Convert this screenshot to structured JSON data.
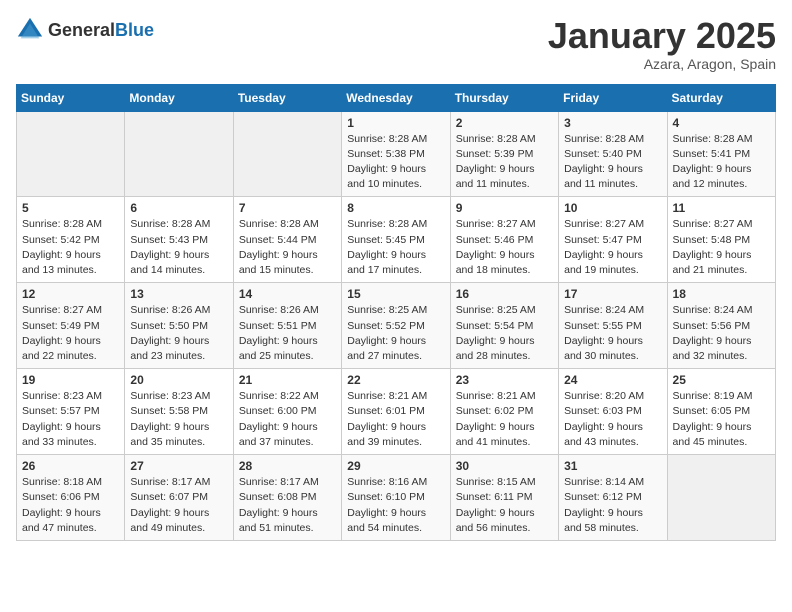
{
  "header": {
    "logo_general": "General",
    "logo_blue": "Blue",
    "month": "January 2025",
    "location": "Azara, Aragon, Spain"
  },
  "weekdays": [
    "Sunday",
    "Monday",
    "Tuesday",
    "Wednesday",
    "Thursday",
    "Friday",
    "Saturday"
  ],
  "weeks": [
    [
      {
        "day": "",
        "info": ""
      },
      {
        "day": "",
        "info": ""
      },
      {
        "day": "",
        "info": ""
      },
      {
        "day": "1",
        "info": "Sunrise: 8:28 AM\nSunset: 5:38 PM\nDaylight: 9 hours\nand 10 minutes."
      },
      {
        "day": "2",
        "info": "Sunrise: 8:28 AM\nSunset: 5:39 PM\nDaylight: 9 hours\nand 11 minutes."
      },
      {
        "day": "3",
        "info": "Sunrise: 8:28 AM\nSunset: 5:40 PM\nDaylight: 9 hours\nand 11 minutes."
      },
      {
        "day": "4",
        "info": "Sunrise: 8:28 AM\nSunset: 5:41 PM\nDaylight: 9 hours\nand 12 minutes."
      }
    ],
    [
      {
        "day": "5",
        "info": "Sunrise: 8:28 AM\nSunset: 5:42 PM\nDaylight: 9 hours\nand 13 minutes."
      },
      {
        "day": "6",
        "info": "Sunrise: 8:28 AM\nSunset: 5:43 PM\nDaylight: 9 hours\nand 14 minutes."
      },
      {
        "day": "7",
        "info": "Sunrise: 8:28 AM\nSunset: 5:44 PM\nDaylight: 9 hours\nand 15 minutes."
      },
      {
        "day": "8",
        "info": "Sunrise: 8:28 AM\nSunset: 5:45 PM\nDaylight: 9 hours\nand 17 minutes."
      },
      {
        "day": "9",
        "info": "Sunrise: 8:27 AM\nSunset: 5:46 PM\nDaylight: 9 hours\nand 18 minutes."
      },
      {
        "day": "10",
        "info": "Sunrise: 8:27 AM\nSunset: 5:47 PM\nDaylight: 9 hours\nand 19 minutes."
      },
      {
        "day": "11",
        "info": "Sunrise: 8:27 AM\nSunset: 5:48 PM\nDaylight: 9 hours\nand 21 minutes."
      }
    ],
    [
      {
        "day": "12",
        "info": "Sunrise: 8:27 AM\nSunset: 5:49 PM\nDaylight: 9 hours\nand 22 minutes."
      },
      {
        "day": "13",
        "info": "Sunrise: 8:26 AM\nSunset: 5:50 PM\nDaylight: 9 hours\nand 23 minutes."
      },
      {
        "day": "14",
        "info": "Sunrise: 8:26 AM\nSunset: 5:51 PM\nDaylight: 9 hours\nand 25 minutes."
      },
      {
        "day": "15",
        "info": "Sunrise: 8:25 AM\nSunset: 5:52 PM\nDaylight: 9 hours\nand 27 minutes."
      },
      {
        "day": "16",
        "info": "Sunrise: 8:25 AM\nSunset: 5:54 PM\nDaylight: 9 hours\nand 28 minutes."
      },
      {
        "day": "17",
        "info": "Sunrise: 8:24 AM\nSunset: 5:55 PM\nDaylight: 9 hours\nand 30 minutes."
      },
      {
        "day": "18",
        "info": "Sunrise: 8:24 AM\nSunset: 5:56 PM\nDaylight: 9 hours\nand 32 minutes."
      }
    ],
    [
      {
        "day": "19",
        "info": "Sunrise: 8:23 AM\nSunset: 5:57 PM\nDaylight: 9 hours\nand 33 minutes."
      },
      {
        "day": "20",
        "info": "Sunrise: 8:23 AM\nSunset: 5:58 PM\nDaylight: 9 hours\nand 35 minutes."
      },
      {
        "day": "21",
        "info": "Sunrise: 8:22 AM\nSunset: 6:00 PM\nDaylight: 9 hours\nand 37 minutes."
      },
      {
        "day": "22",
        "info": "Sunrise: 8:21 AM\nSunset: 6:01 PM\nDaylight: 9 hours\nand 39 minutes."
      },
      {
        "day": "23",
        "info": "Sunrise: 8:21 AM\nSunset: 6:02 PM\nDaylight: 9 hours\nand 41 minutes."
      },
      {
        "day": "24",
        "info": "Sunrise: 8:20 AM\nSunset: 6:03 PM\nDaylight: 9 hours\nand 43 minutes."
      },
      {
        "day": "25",
        "info": "Sunrise: 8:19 AM\nSunset: 6:05 PM\nDaylight: 9 hours\nand 45 minutes."
      }
    ],
    [
      {
        "day": "26",
        "info": "Sunrise: 8:18 AM\nSunset: 6:06 PM\nDaylight: 9 hours\nand 47 minutes."
      },
      {
        "day": "27",
        "info": "Sunrise: 8:17 AM\nSunset: 6:07 PM\nDaylight: 9 hours\nand 49 minutes."
      },
      {
        "day": "28",
        "info": "Sunrise: 8:17 AM\nSunset: 6:08 PM\nDaylight: 9 hours\nand 51 minutes."
      },
      {
        "day": "29",
        "info": "Sunrise: 8:16 AM\nSunset: 6:10 PM\nDaylight: 9 hours\nand 54 minutes."
      },
      {
        "day": "30",
        "info": "Sunrise: 8:15 AM\nSunset: 6:11 PM\nDaylight: 9 hours\nand 56 minutes."
      },
      {
        "day": "31",
        "info": "Sunrise: 8:14 AM\nSunset: 6:12 PM\nDaylight: 9 hours\nand 58 minutes."
      },
      {
        "day": "",
        "info": ""
      }
    ]
  ]
}
